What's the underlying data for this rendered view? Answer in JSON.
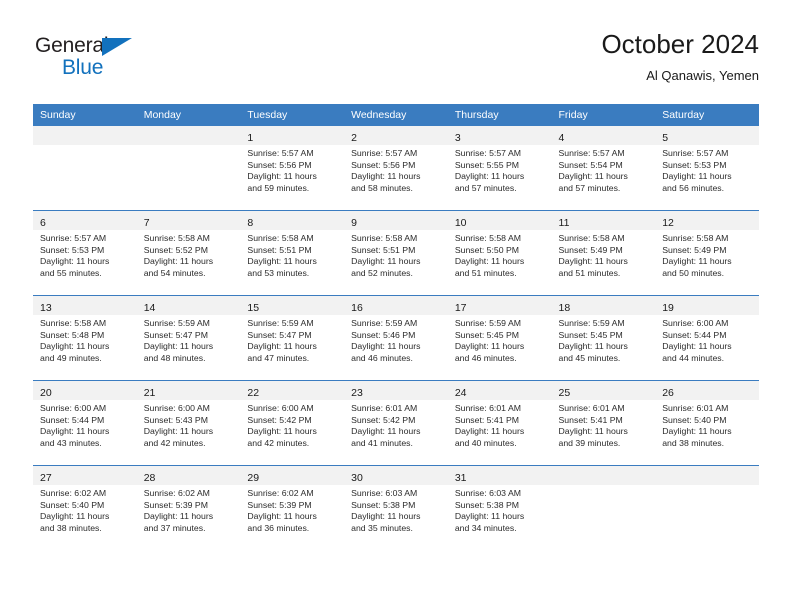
{
  "brand": {
    "name_top": "General",
    "name_bottom": "Blue",
    "color_dark": "#231f20",
    "color_blue": "#1271bd"
  },
  "header": {
    "title": "October 2024",
    "subtitle": "Al Qanawis, Yemen"
  },
  "theme": {
    "header_blue": "#3a7cc0",
    "band_gray": "#f2f2f2",
    "text": "#2b2b2b"
  },
  "weekdays": [
    "Sunday",
    "Monday",
    "Tuesday",
    "Wednesday",
    "Thursday",
    "Friday",
    "Saturday"
  ],
  "weeks": [
    [
      {
        "day": "",
        "lines": []
      },
      {
        "day": "",
        "lines": []
      },
      {
        "day": "1",
        "lines": [
          "Sunrise: 5:57 AM",
          "Sunset: 5:56 PM",
          "Daylight: 11 hours",
          "and 59 minutes."
        ]
      },
      {
        "day": "2",
        "lines": [
          "Sunrise: 5:57 AM",
          "Sunset: 5:56 PM",
          "Daylight: 11 hours",
          "and 58 minutes."
        ]
      },
      {
        "day": "3",
        "lines": [
          "Sunrise: 5:57 AM",
          "Sunset: 5:55 PM",
          "Daylight: 11 hours",
          "and 57 minutes."
        ]
      },
      {
        "day": "4",
        "lines": [
          "Sunrise: 5:57 AM",
          "Sunset: 5:54 PM",
          "Daylight: 11 hours",
          "and 57 minutes."
        ]
      },
      {
        "day": "5",
        "lines": [
          "Sunrise: 5:57 AM",
          "Sunset: 5:53 PM",
          "Daylight: 11 hours",
          "and 56 minutes."
        ]
      }
    ],
    [
      {
        "day": "6",
        "lines": [
          "Sunrise: 5:57 AM",
          "Sunset: 5:53 PM",
          "Daylight: 11 hours",
          "and 55 minutes."
        ]
      },
      {
        "day": "7",
        "lines": [
          "Sunrise: 5:58 AM",
          "Sunset: 5:52 PM",
          "Daylight: 11 hours",
          "and 54 minutes."
        ]
      },
      {
        "day": "8",
        "lines": [
          "Sunrise: 5:58 AM",
          "Sunset: 5:51 PM",
          "Daylight: 11 hours",
          "and 53 minutes."
        ]
      },
      {
        "day": "9",
        "lines": [
          "Sunrise: 5:58 AM",
          "Sunset: 5:51 PM",
          "Daylight: 11 hours",
          "and 52 minutes."
        ]
      },
      {
        "day": "10",
        "lines": [
          "Sunrise: 5:58 AM",
          "Sunset: 5:50 PM",
          "Daylight: 11 hours",
          "and 51 minutes."
        ]
      },
      {
        "day": "11",
        "lines": [
          "Sunrise: 5:58 AM",
          "Sunset: 5:49 PM",
          "Daylight: 11 hours",
          "and 51 minutes."
        ]
      },
      {
        "day": "12",
        "lines": [
          "Sunrise: 5:58 AM",
          "Sunset: 5:49 PM",
          "Daylight: 11 hours",
          "and 50 minutes."
        ]
      }
    ],
    [
      {
        "day": "13",
        "lines": [
          "Sunrise: 5:58 AM",
          "Sunset: 5:48 PM",
          "Daylight: 11 hours",
          "and 49 minutes."
        ]
      },
      {
        "day": "14",
        "lines": [
          "Sunrise: 5:59 AM",
          "Sunset: 5:47 PM",
          "Daylight: 11 hours",
          "and 48 minutes."
        ]
      },
      {
        "day": "15",
        "lines": [
          "Sunrise: 5:59 AM",
          "Sunset: 5:47 PM",
          "Daylight: 11 hours",
          "and 47 minutes."
        ]
      },
      {
        "day": "16",
        "lines": [
          "Sunrise: 5:59 AM",
          "Sunset: 5:46 PM",
          "Daylight: 11 hours",
          "and 46 minutes."
        ]
      },
      {
        "day": "17",
        "lines": [
          "Sunrise: 5:59 AM",
          "Sunset: 5:45 PM",
          "Daylight: 11 hours",
          "and 46 minutes."
        ]
      },
      {
        "day": "18",
        "lines": [
          "Sunrise: 5:59 AM",
          "Sunset: 5:45 PM",
          "Daylight: 11 hours",
          "and 45 minutes."
        ]
      },
      {
        "day": "19",
        "lines": [
          "Sunrise: 6:00 AM",
          "Sunset: 5:44 PM",
          "Daylight: 11 hours",
          "and 44 minutes."
        ]
      }
    ],
    [
      {
        "day": "20",
        "lines": [
          "Sunrise: 6:00 AM",
          "Sunset: 5:44 PM",
          "Daylight: 11 hours",
          "and 43 minutes."
        ]
      },
      {
        "day": "21",
        "lines": [
          "Sunrise: 6:00 AM",
          "Sunset: 5:43 PM",
          "Daylight: 11 hours",
          "and 42 minutes."
        ]
      },
      {
        "day": "22",
        "lines": [
          "Sunrise: 6:00 AM",
          "Sunset: 5:42 PM",
          "Daylight: 11 hours",
          "and 42 minutes."
        ]
      },
      {
        "day": "23",
        "lines": [
          "Sunrise: 6:01 AM",
          "Sunset: 5:42 PM",
          "Daylight: 11 hours",
          "and 41 minutes."
        ]
      },
      {
        "day": "24",
        "lines": [
          "Sunrise: 6:01 AM",
          "Sunset: 5:41 PM",
          "Daylight: 11 hours",
          "and 40 minutes."
        ]
      },
      {
        "day": "25",
        "lines": [
          "Sunrise: 6:01 AM",
          "Sunset: 5:41 PM",
          "Daylight: 11 hours",
          "and 39 minutes."
        ]
      },
      {
        "day": "26",
        "lines": [
          "Sunrise: 6:01 AM",
          "Sunset: 5:40 PM",
          "Daylight: 11 hours",
          "and 38 minutes."
        ]
      }
    ],
    [
      {
        "day": "27",
        "lines": [
          "Sunrise: 6:02 AM",
          "Sunset: 5:40 PM",
          "Daylight: 11 hours",
          "and 38 minutes."
        ]
      },
      {
        "day": "28",
        "lines": [
          "Sunrise: 6:02 AM",
          "Sunset: 5:39 PM",
          "Daylight: 11 hours",
          "and 37 minutes."
        ]
      },
      {
        "day": "29",
        "lines": [
          "Sunrise: 6:02 AM",
          "Sunset: 5:39 PM",
          "Daylight: 11 hours",
          "and 36 minutes."
        ]
      },
      {
        "day": "30",
        "lines": [
          "Sunrise: 6:03 AM",
          "Sunset: 5:38 PM",
          "Daylight: 11 hours",
          "and 35 minutes."
        ]
      },
      {
        "day": "31",
        "lines": [
          "Sunrise: 6:03 AM",
          "Sunset: 5:38 PM",
          "Daylight: 11 hours",
          "and 34 minutes."
        ]
      },
      {
        "day": "",
        "lines": []
      },
      {
        "day": "",
        "lines": []
      }
    ]
  ]
}
